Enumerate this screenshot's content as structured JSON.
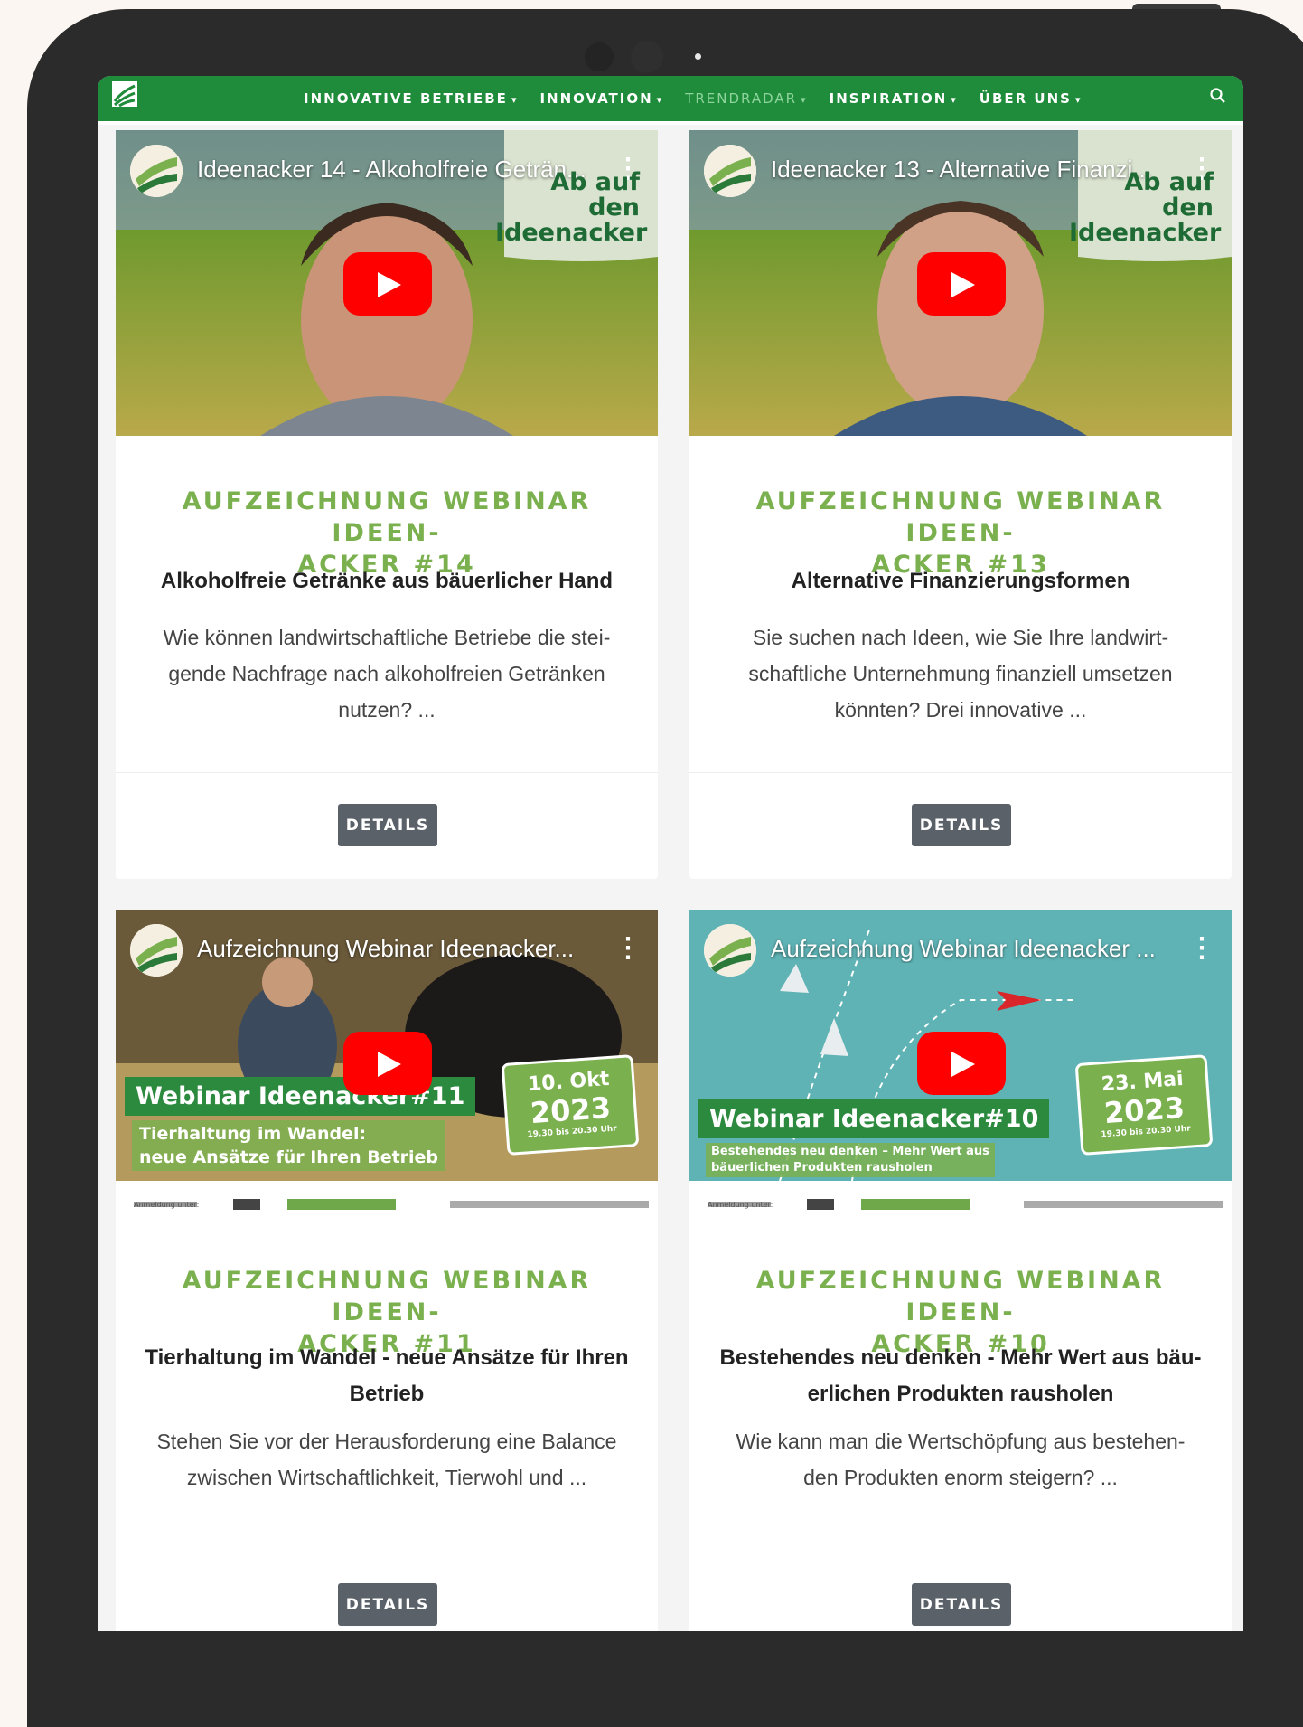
{
  "nav": {
    "items": [
      {
        "label": "INNOVATIVE BETRIEBE"
      },
      {
        "label": "INNOVATION"
      },
      {
        "label": "TRENDRADAR"
      },
      {
        "label": "INSPIRATION"
      },
      {
        "label": "ÜBER UNS"
      }
    ],
    "active_index": 2,
    "colors": {
      "nav_bg": "#1e8c3a",
      "active": "#8fd49d"
    }
  },
  "cards": [
    {
      "video_title": "Ideenacker 14 - Alkoholfreie Geträn...",
      "overlay_line1": "Ab auf den",
      "overlay_line2": "Ideenacker",
      "title_line1": "AUFZEICHNUNG WEBINAR IDEEN-",
      "title_line2": "ACKER #14",
      "subtitle": "Alkoholfreie Getränke aus bäuerlicher Hand",
      "text_line1": "Wie können landwirtschaftliche Betriebe die stei-",
      "text_line2": "gende Nachfrage nach alkoholfreien Getränken",
      "text_line3": "nutzen? ...",
      "button": "DETAILS"
    },
    {
      "video_title": "Ideenacker 13 - Alternative Finanzi...",
      "overlay_line1": "Ab auf den",
      "overlay_line2": "Ideenacker",
      "title_line1": "AUFZEICHNUNG WEBINAR IDEEN-",
      "title_line2": "ACKER #13",
      "subtitle": "Alternative Finanzierungsformen",
      "text_line1": "Sie suchen nach Ideen, wie Sie Ihre landwirt-",
      "text_line2": "schaftliche Unternehmung finanziell umsetzen",
      "text_line3": "könnten? Drei innovative ...",
      "button": "DETAILS"
    },
    {
      "video_title": "Aufzeichnung Webinar Ideenacker...",
      "banner": "Webinar Ideenacker#11",
      "banner_sub1": "Tierhaltung im Wandel:",
      "banner_sub2": "neue Ansätze für Ihren Betrieb",
      "date_day": "10. Okt",
      "date_year": "2023",
      "date_time": "19.30 bis 20.30 Uhr",
      "footer_label": "Anmeldung unter:",
      "title_line1": "AUFZEICHNUNG WEBINAR IDEEN-",
      "title_line2": "ACKER #11",
      "subtitle_line1": "Tierhaltung im Wandel - neue Ansätze für Ihren",
      "subtitle_line2": "Betrieb",
      "text_line1": "Stehen Sie vor der Herausforderung eine Balance",
      "text_line2": "zwischen Wirtschaftlichkeit, Tierwohl und ...",
      "button": "DETAILS"
    },
    {
      "video_title": "Aufzeichnung Webinar Ideenacker ...",
      "banner": "Webinar Ideenacker#10",
      "banner_sub1": "Bestehendes neu denken – Mehr Wert aus",
      "banner_sub2": "bäuerlichen Produkten rausholen",
      "date_day": "23. Mai",
      "date_year": "2023",
      "date_time": "19.30 bis 20.30 Uhr",
      "footer_label": "Anmeldung unter:",
      "title_line1": "AUFZEICHNUNG WEBINAR IDEEN-",
      "title_line2": "ACKER #10",
      "subtitle_line1": "Bestehendes neu denken - Mehr Wert aus bäu-",
      "subtitle_line2": "erlichen Produkten rausholen",
      "text_line1": "Wie kann man die Wertschöpfung aus bestehen-",
      "text_line2": "den Produkten enorm steigern? ...",
      "button": "DETAILS"
    }
  ],
  "icons": {
    "logo": "logo-icon",
    "search": "search-icon",
    "play": "play-icon",
    "menu": "kebab-menu-icon"
  }
}
